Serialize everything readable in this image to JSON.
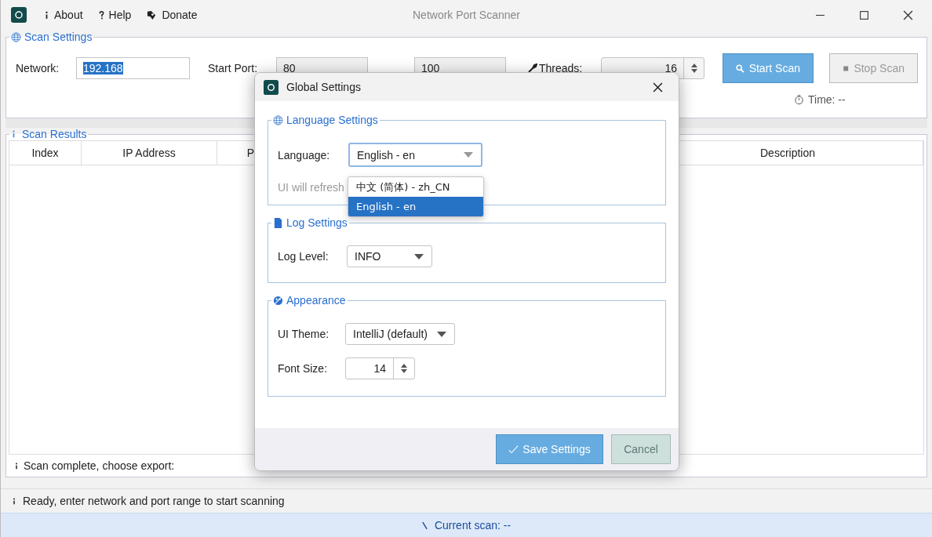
{
  "window": {
    "title": "Network Port Scanner"
  },
  "menu": [
    {
      "kind": "info",
      "label": "About"
    },
    {
      "kind": "help",
      "label": "Help"
    },
    {
      "kind": "donate",
      "label": "Donate"
    }
  ],
  "scan_settings": {
    "title": "Scan Settings",
    "network_label": "Network:",
    "network_value": "192.168",
    "start_port_label": "Start Port:",
    "start_port_value": "80",
    "end_port_value": "100",
    "threads_label": "Threads:",
    "threads_value": "16",
    "buttons": [
      {
        "kind": "start",
        "label": "Start Scan",
        "disabled": false
      },
      {
        "kind": "stop",
        "label": "Stop Scan",
        "disabled": true
      }
    ],
    "time": "Time: --"
  },
  "scan_results": {
    "title": "Scan Results",
    "columns": [
      "Index",
      "IP Address",
      "P",
      "Description"
    ],
    "footer": "Scan complete, choose export:"
  },
  "status_bar": "Ready, enter network and port range to start scanning",
  "current_scan": "Current scan: --",
  "dialog": {
    "title": "Global Settings",
    "language": {
      "title": "Language Settings",
      "label": "Language:",
      "value": "English - en",
      "hint": "UI will refresh",
      "options": [
        {
          "label": "中文 (简体) - zh_CN",
          "selected": false
        },
        {
          "label": "English - en",
          "selected": true
        }
      ]
    },
    "log": {
      "title": "Log Settings",
      "label": "Log Level:",
      "value": "INFO"
    },
    "appearance": {
      "title": "Appearance",
      "theme_label": "UI Theme:",
      "theme_value": "IntelliJ (default)",
      "font_label": "Font Size:",
      "font_value": "14"
    },
    "buttons": [
      {
        "kind": "save",
        "label": "Save Settings",
        "disabled": false
      },
      {
        "kind": "cancel",
        "label": "Cancel",
        "disabled": true
      }
    ]
  }
}
